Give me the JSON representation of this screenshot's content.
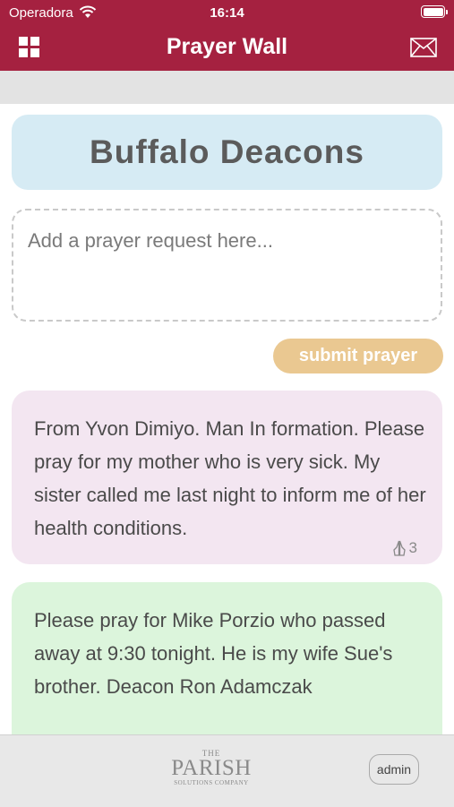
{
  "status_bar": {
    "carrier": "Operadora",
    "time": "16:14"
  },
  "nav": {
    "title": "Prayer Wall",
    "menu_icon": "grid-icon",
    "mail_icon": "envelope-icon"
  },
  "group": {
    "title": "Buffalo Deacons"
  },
  "request": {
    "placeholder": "Add a prayer request here...",
    "value": ""
  },
  "submit": {
    "label": "submit prayer"
  },
  "prayers": [
    {
      "text": "From Yvon Dimiyo. Man In formation. Please pray for my mother who is very sick. My sister called me last night to inform me of her health conditions.",
      "count": "3",
      "background": "#f3e6f1"
    },
    {
      "text": "Please pray for Mike Porzio who passed away at 9:30 tonight. He is my wife Sue's brother. Deacon Ron Adamczak",
      "count": "",
      "background": "#dcf5dc"
    }
  ],
  "footer": {
    "logo": {
      "the": "THE",
      "main": "PARISH",
      "sub": "SOLUTIONS COMPANY"
    },
    "admin_label": "admin"
  },
  "colors": {
    "brand": "#a52140",
    "accent": "#eac891",
    "group_bg": "#d6ebf4"
  }
}
